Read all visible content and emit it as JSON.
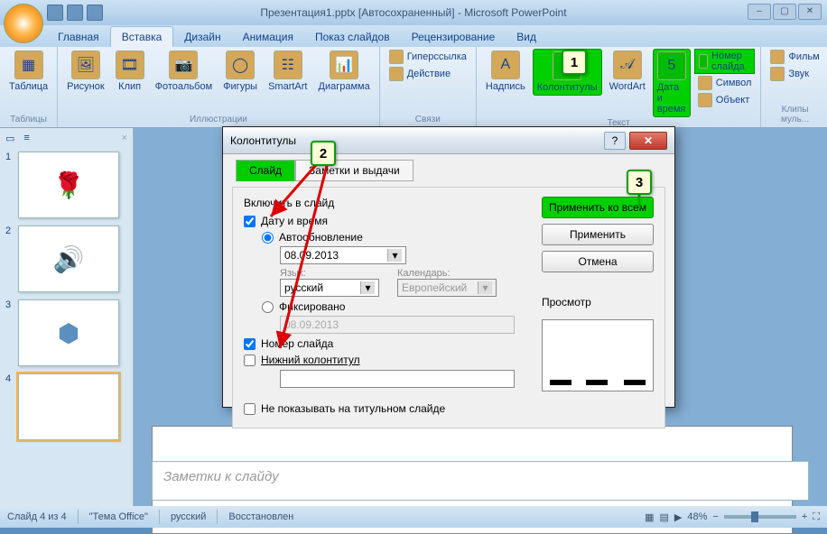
{
  "title": "Презентация1.pptx [Автосохраненный] - Microsoft PowerPoint",
  "tabs": [
    "Главная",
    "Вставка",
    "Дизайн",
    "Анимация",
    "Показ слайдов",
    "Рецензирование",
    "Вид"
  ],
  "ribbon": {
    "tables": {
      "label": "Таблицы",
      "table": "Таблица"
    },
    "illus": {
      "label": "Иллюстрации",
      "pic": "Рисунок",
      "clip": "Клип",
      "album": "Фотоальбом",
      "shapes": "Фигуры",
      "smartart": "SmartArt",
      "chart": "Диаграмма"
    },
    "links": {
      "label": "Связи",
      "hyper": "Гиперссылка",
      "action": "Действие"
    },
    "text": {
      "label": "Текст",
      "textbox": "Надпись",
      "hf": "Колонтитулы",
      "wordart": "WordArt",
      "dt": "Дата и время",
      "slidenum": "Номер слайда",
      "symbol": "Символ",
      "object": "Объект"
    },
    "media": {
      "label": "Клипы муль...",
      "movie": "Фильм",
      "sound": "Звук"
    }
  },
  "thumbs": [
    "1",
    "2",
    "3",
    "4"
  ],
  "notes_placeholder": "Заметки к слайду",
  "status": {
    "slide": "Слайд 4 из 4",
    "theme": "\"Тема Office\"",
    "lang": "русский",
    "recovered": "Восстановлен",
    "zoom": "48%"
  },
  "dialog": {
    "title": "Колонтитулы",
    "tab_slide": "Слайд",
    "tab_notes": "Заметки и выдачи",
    "include": "Включить в слайд",
    "dt": "Дату и время",
    "auto": "Автообновление",
    "date": "08.09.2013",
    "lang_lbl": "Язык:",
    "lang_val": "русский",
    "cal_lbl": "Календарь:",
    "cal_val": "Европейский",
    "fixed": "Фиксировано",
    "fixed_val": "08.09.2013",
    "slidenum": "Номер слайда",
    "footer": "Нижний колонтитул",
    "notitle": "Не показывать на титульном слайде",
    "apply_all": "Применить ко всем",
    "apply": "Применить",
    "cancel": "Отмена",
    "preview": "Просмотр"
  },
  "markers": {
    "m1": "1",
    "m2": "2",
    "m3": "3"
  }
}
